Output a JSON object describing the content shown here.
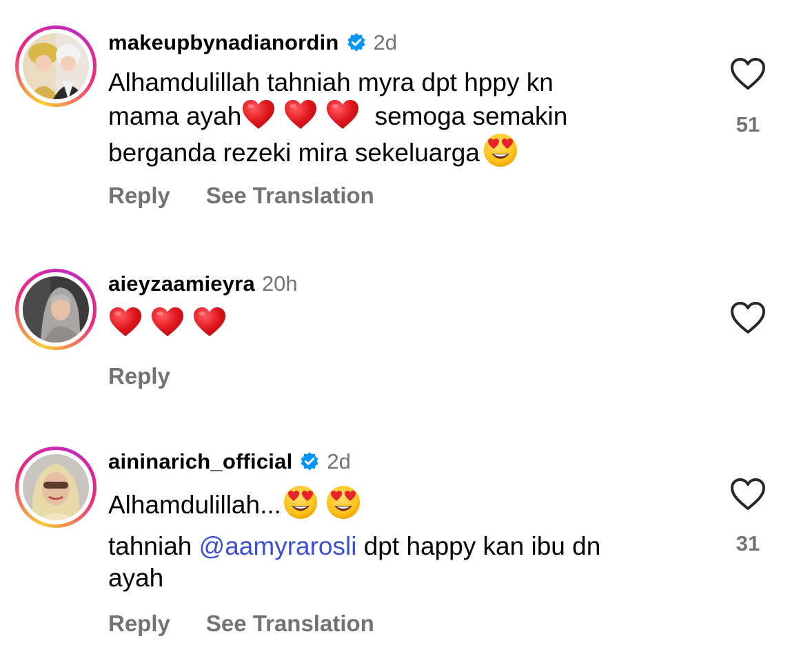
{
  "comments": [
    {
      "username": "makeupbynadianordin",
      "time": "2d",
      "verified": true,
      "lines": [
        "Alhamdulillah tahniah myra dpt hppy kn",
        "mama ayah",
        "semoga semakin",
        "berganda rezeki mira sekeluarga"
      ],
      "reply_label": "Reply",
      "translate_label": "See Translation",
      "like_count": "51"
    },
    {
      "username": "aieyzaamieyra",
      "time": "20h",
      "verified": false,
      "reply_label": "Reply"
    },
    {
      "username": "aininarich_official",
      "time": "2d",
      "verified": true,
      "lines": [
        "Alhamdulillah...",
        "tahniah",
        "@aamyrarosli",
        "dpt happy kan ibu dn",
        "ayah"
      ],
      "reply_label": "Reply",
      "translate_label": "See Translation",
      "like_count": "31"
    }
  ],
  "colors": {
    "secondary_text": "#737373",
    "mention": "#3b4fd8",
    "heart": "#e0161d",
    "verified": "#0095f6"
  },
  "icons": {
    "like": "heart-outline-icon",
    "verified": "verified-badge-icon",
    "emoji_heart": "red-heart-emoji",
    "emoji_face": "heart-eyes-emoji"
  }
}
